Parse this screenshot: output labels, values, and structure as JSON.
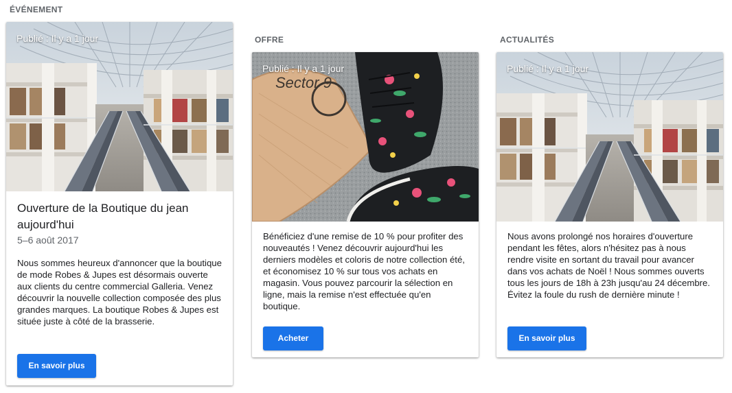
{
  "columns": [
    {
      "label": "ÉVÉNEMENT",
      "published": "Publié : Il y a 1 jour",
      "image": "shopping-mall-photo",
      "title": "Ouverture de la Boutique du jean aujourd'hui",
      "date": "5–6 août 2017",
      "description": "Nous sommes heureux d'annoncer que la boutique de mode Robes & Jupes est désormais ouverte aux clients du centre commercial Galleria. Venez découvrir la nouvelle collection composée des plus grandes marques. La boutique Robes & Jupes est située juste à côté de la brasserie.",
      "button": "En savoir plus"
    },
    {
      "label": "OFFRE",
      "published": "Publié : Il y a 1 jour",
      "image": "sneakers-skateboard-photo",
      "description": "Bénéficiez d'une remise de 10 % pour profiter des nouveautés ! Venez découvrir aujourd'hui les derniers modèles et coloris de notre collection été, et économisez 10 % sur tous vos achats en magasin. Vous pouvez parcourir la sélection en ligne, mais la remise n'est effectuée qu'en boutique.",
      "button": "Acheter"
    },
    {
      "label": "ACTUALITÉS",
      "published": "Publié : Il y a 1 jour",
      "image": "shopping-mall-photo",
      "description": "Nous avons prolongé nos horaires d'ouverture pendant les fêtes, alors n'hésitez pas à nous rendre visite en sortant du travail pour avancer dans vos achats de Noël ! Nous sommes ouverts tous les jours de 18h à 23h jusqu'au 24 décembre. Évitez la foule du rush de dernière minute !",
      "button": "En savoir plus"
    }
  ],
  "colors": {
    "accent": "#1a73e8",
    "label": "#5f6368",
    "text": "#202124"
  }
}
